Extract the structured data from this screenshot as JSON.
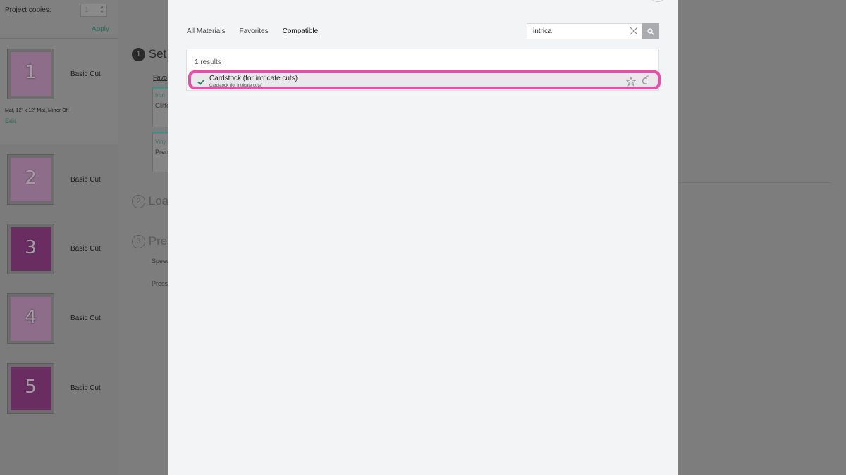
{
  "sidebar": {
    "project_copies_label": "Project copies:",
    "project_copies_value": "1",
    "apply_label": "Apply",
    "mat_info": "Mat, 12\" x 12\" Mat, Mirror Off",
    "edit_label": "Edit",
    "mats": [
      {
        "number": "1",
        "label": "Basic Cut"
      },
      {
        "number": "2",
        "label": "Basic Cut"
      },
      {
        "number": "3",
        "label": "Basic Cut"
      },
      {
        "number": "4",
        "label": "Basic Cut"
      },
      {
        "number": "5",
        "label": "Basic Cut"
      }
    ]
  },
  "background": {
    "step1_number": "1",
    "step1_text": "Set",
    "step2_number": "2",
    "step2_text": "Loa",
    "step3_number": "3",
    "step3_text": "Pres",
    "favorites_fragment": "Favo",
    "card1_category": "Iron",
    "card1_name": "Glitte",
    "card2_category": "Viny",
    "card2_name": "Pren",
    "speed_fragment": "Speed",
    "pressure_fragment": "Pressu"
  },
  "modal": {
    "tabs": [
      {
        "label": "All Materials"
      },
      {
        "label": "Favorites"
      },
      {
        "label": "Compatible"
      }
    ],
    "search": {
      "value": "intrica"
    },
    "results_count": "1 results",
    "result": {
      "title": "Cardstock (for intricate cuts)",
      "subtitle": "Cardstock (for intricate cuts)"
    }
  },
  "colors": {
    "highlight": "#e44fa8",
    "check": "#2e8b57",
    "overlay": "#7d7d7d",
    "modal_bg": "#f3f4f6"
  }
}
